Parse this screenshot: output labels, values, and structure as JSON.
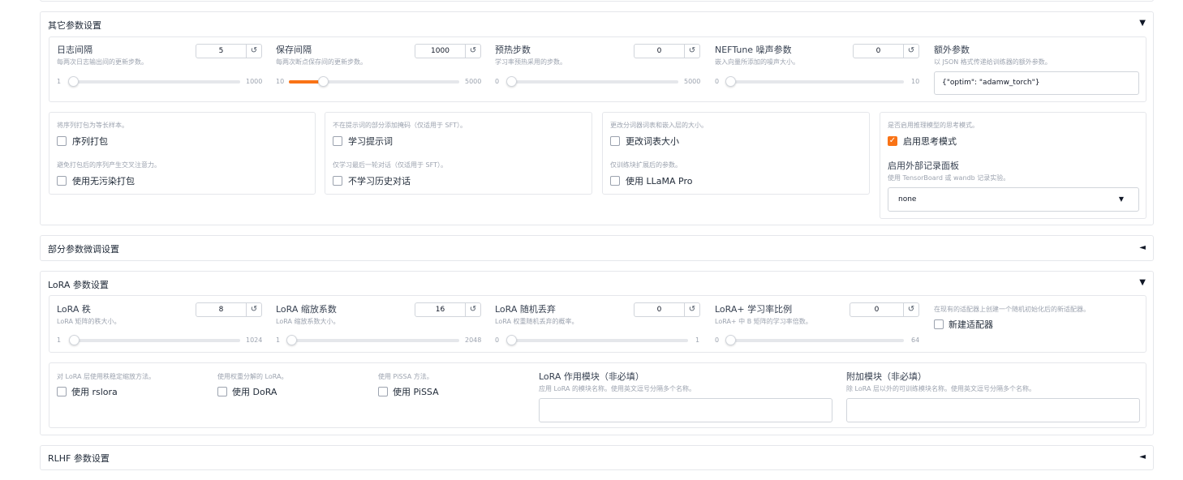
{
  "other": {
    "title": "其它参数设置",
    "arrow": "▼",
    "sliders": [
      {
        "label": "日志间隔",
        "info": "每两次日志输出间的更新步数。",
        "value": "5",
        "min": "1",
        "max": "1000",
        "fraction": 0.004
      },
      {
        "label": "保存间隔",
        "info": "每两次断点保存间的更新步数。",
        "value": "1000",
        "min": "10",
        "max": "5000",
        "fraction": 0.2
      },
      {
        "label": "预热步数",
        "info": "学习率预热采用的步数。",
        "value": "0",
        "min": "0",
        "max": "5000",
        "fraction": 0
      },
      {
        "label": "NEFTune 噪声参数",
        "info": "嵌入向量所添加的噪声大小。",
        "value": "0",
        "min": "0",
        "max": "10",
        "fraction": 0
      }
    ],
    "extra": {
      "label": "额外参数",
      "info": "以 JSON 格式传递给训练器的额外参数。",
      "value": "{\"optim\": \"adamw_torch\"}"
    },
    "checks": [
      {
        "info": "将序列打包为等长样本。",
        "label": "序列打包",
        "checked": false
      },
      {
        "info": "避免打包后的序列产生交叉注意力。",
        "label": "使用无污染打包",
        "checked": false
      },
      {
        "info": "不在提示词的部分添加掩码（仅适用于 SFT）。",
        "label": "学习提示词",
        "checked": false
      },
      {
        "info": "仅学习最后一轮对话（仅适用于 SFT）。",
        "label": "不学习历史对话",
        "checked": false
      },
      {
        "info": "更改分词器词表和嵌入层的大小。",
        "label": "更改词表大小",
        "checked": false
      },
      {
        "info": "仅训练块扩展后的参数。",
        "label": "使用 LLaMA Pro",
        "checked": false
      },
      {
        "info": "是否启用推理模型的思考模式。",
        "label": "启用思考模式",
        "checked": true
      }
    ],
    "report": {
      "label": "启用外部记录面板",
      "info": "使用 TensorBoard 或 wandb 记录实验。",
      "value": "none",
      "caret": "▼"
    }
  },
  "freeze": {
    "title": "部分参数微调设置",
    "arrow": "◄"
  },
  "lora": {
    "title": "LoRA 参数设置",
    "arrow": "▼",
    "sliders": [
      {
        "label": "LoRA 秩",
        "info": "LoRA 矩阵的秩大小。",
        "value": "8",
        "min": "1",
        "max": "1024",
        "fraction": 0.007
      },
      {
        "label": "LoRA 缩放系数",
        "info": "LoRA 缩放系数大小。",
        "value": "16",
        "min": "1",
        "max": "2048",
        "fraction": 0.007
      },
      {
        "label": "LoRA 随机丢弃",
        "info": "LoRA 权重随机丢弃的概率。",
        "value": "0",
        "min": "0",
        "max": "1",
        "fraction": 0
      },
      {
        "label": "LoRA+ 学习率比例",
        "info": "LoRA+ 中 B 矩阵的学习率倍数。",
        "value": "0",
        "min": "0",
        "max": "64",
        "fraction": 0
      }
    ],
    "new_adapter": {
      "info": "在现有的适配器上创建一个随机初始化后的新适配器。",
      "label": "新建适配器",
      "checked": false
    },
    "checks": [
      {
        "info": "对 LoRA 层使用秩稳定缩放方法。",
        "label": "使用 rslora",
        "checked": false
      },
      {
        "info": "使用权重分解的 LoRA。",
        "label": "使用 DoRA",
        "checked": false
      },
      {
        "info": "使用 PiSSA 方法。",
        "label": "使用 PiSSA",
        "checked": false
      }
    ],
    "target": {
      "label": "LoRA 作用模块（非必填）",
      "info": "应用 LoRA 的模块名称。使用英文逗号分隔多个名称。",
      "value": ""
    },
    "additional": {
      "label": "附加模块（非必填）",
      "info": "除 LoRA 层以外的可训练模块名称。使用英文逗号分隔多个名称。",
      "value": ""
    }
  },
  "rlhf": {
    "title": "RLHF 参数设置",
    "arrow": "◄"
  },
  "reset_icon": "↺",
  "check_mark": "✓"
}
